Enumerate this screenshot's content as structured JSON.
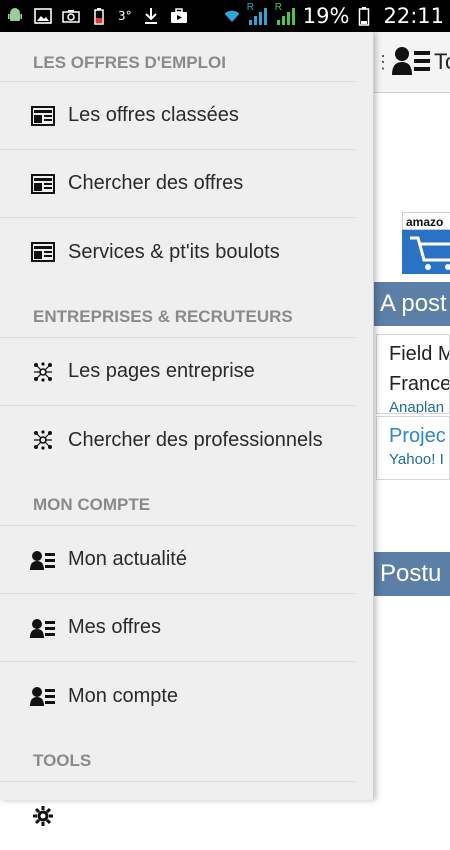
{
  "status_bar": {
    "notification_small": "3°",
    "signal_roaming_1": "R",
    "signal_roaming_2": "R",
    "battery_percent": "19%",
    "time": "22:11"
  },
  "background_app": {
    "title": "To",
    "ad_text": "amazo",
    "section_recent": "A post",
    "jobs": [
      {
        "title_line1": "Field M",
        "title_line2": "France",
        "company": "Anaplan"
      },
      {
        "title_line1": "Projec",
        "company": "Yahoo! I"
      }
    ],
    "section_posted": "Postu"
  },
  "drawer": {
    "sections": [
      {
        "heading": "LES OFFRES D'EMPLOI",
        "items": [
          {
            "label": "Les offres classées",
            "icon": "newspaper-icon"
          },
          {
            "label": "Chercher des offres",
            "icon": "newspaper-icon"
          },
          {
            "label": "Services & pt'its boulots",
            "icon": "newspaper-icon"
          }
        ]
      },
      {
        "heading": "ENTREPRISES & RECRUTEURS",
        "items": [
          {
            "label": "Les pages entreprise",
            "icon": "network-icon"
          },
          {
            "label": "Chercher des professionnels",
            "icon": "network-icon"
          }
        ]
      },
      {
        "heading": "MON COMPTE",
        "items": [
          {
            "label": "Mon actualité",
            "icon": "profile-card-icon"
          },
          {
            "label": "Mes offres",
            "icon": "profile-card-icon"
          },
          {
            "label": "Mon compte",
            "icon": "profile-card-icon"
          }
        ]
      },
      {
        "heading": "TOOLS",
        "items": [
          {
            "label": "",
            "icon": "gear-icon"
          }
        ]
      }
    ]
  }
}
